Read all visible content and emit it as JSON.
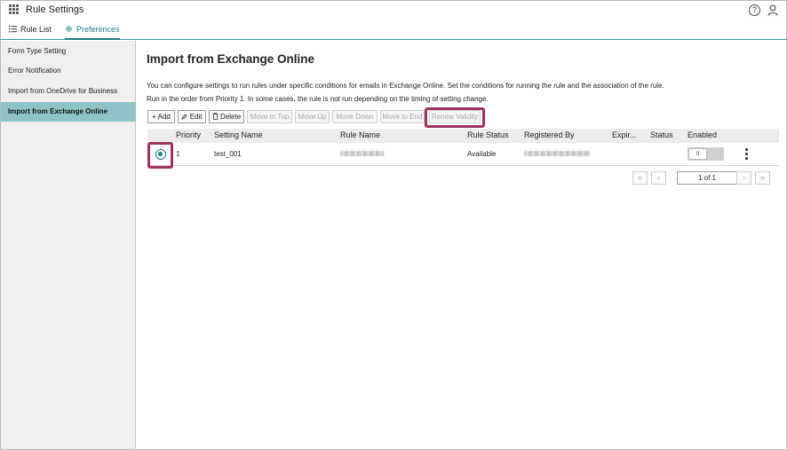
{
  "app": {
    "title": "Rule Settings"
  },
  "header": {
    "help_icon": "help-icon",
    "user_icon": "user-icon",
    "help_glyph": "?"
  },
  "tabs": [
    {
      "label": "Rule List",
      "icon": "list-icon"
    },
    {
      "label": "Preferences",
      "icon": "gear-icon",
      "active": true
    }
  ],
  "sidebar": {
    "items": [
      {
        "label": "Form Type Setting"
      },
      {
        "label": "Error Notification"
      },
      {
        "label": "Import from OneDrive for Business"
      },
      {
        "label": "Import from Exchange Online",
        "active": true
      }
    ]
  },
  "main": {
    "title": "Import from Exchange Online",
    "description_line1": "You can configure settings to run rules under specific conditions for emails in Exchange Online. Set the conditions for running the rule and the association of the rule.",
    "description_line2": "Run in the order from Priority 1. In some cases, the rule is not run depending on the timing of setting change."
  },
  "toolbar": {
    "add": "Add",
    "edit": "Edit",
    "delete": "Delete",
    "move_to_top": "Move to Top",
    "move_up": "Move Up",
    "move_down": "Move Down",
    "move_to_end": "Move to End",
    "renew_validity": "Renew Validity"
  },
  "table": {
    "columns": [
      "Priority",
      "Setting Name",
      "Rule Name",
      "Rule Status",
      "Registered By",
      "Expir...",
      "Status",
      "Enabled"
    ],
    "rows": [
      {
        "selected": true,
        "priority": "1",
        "setting_name": "test_001",
        "rule_name": "",
        "rule_status": "Available",
        "registered_by": "",
        "expiration": "",
        "status": "",
        "enabled": false,
        "toggle_glyph": "II"
      }
    ]
  },
  "pager": {
    "page_label": "1 of 1"
  },
  "colors": {
    "accent": "#1a7f8a",
    "sidebar_active": "#8fc3c8",
    "highlight": "#a0305f"
  }
}
